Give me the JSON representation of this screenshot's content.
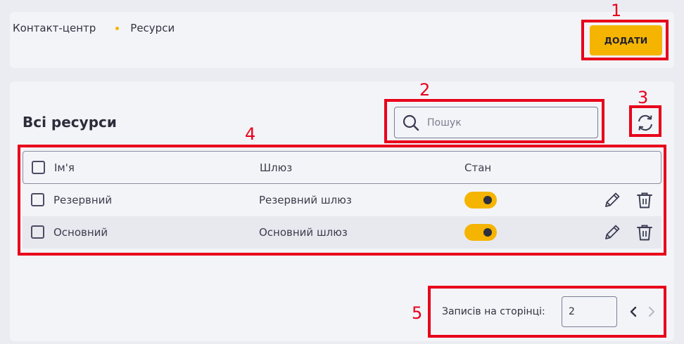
{
  "breadcrumb": {
    "parent": "Контакт-центр",
    "current": "Ресурси"
  },
  "header": {
    "add_label": "ДОДАТИ"
  },
  "main": {
    "title": "Всі ресурси",
    "search_placeholder": "Пошук",
    "columns": {
      "name": "Ім'я",
      "gateway": "Шлюз",
      "state": "Стан"
    },
    "rows": [
      {
        "name": "Резервний",
        "gateway": "Резервний шлюз",
        "enabled": true
      },
      {
        "name": "Основний",
        "gateway": "Основний шлюз",
        "enabled": true
      }
    ]
  },
  "pagination": {
    "label": "Записів на сторінці:",
    "per_page": "2"
  },
  "annotations": [
    "1",
    "2",
    "3",
    "4",
    "5"
  ],
  "colors": {
    "accent": "#f5b400",
    "annotation": "#e8001a",
    "text": "#303240"
  },
  "icons": [
    "search-icon",
    "refresh-icon",
    "edit-icon",
    "trash-icon",
    "chevron-left-icon",
    "chevron-right-icon"
  ]
}
